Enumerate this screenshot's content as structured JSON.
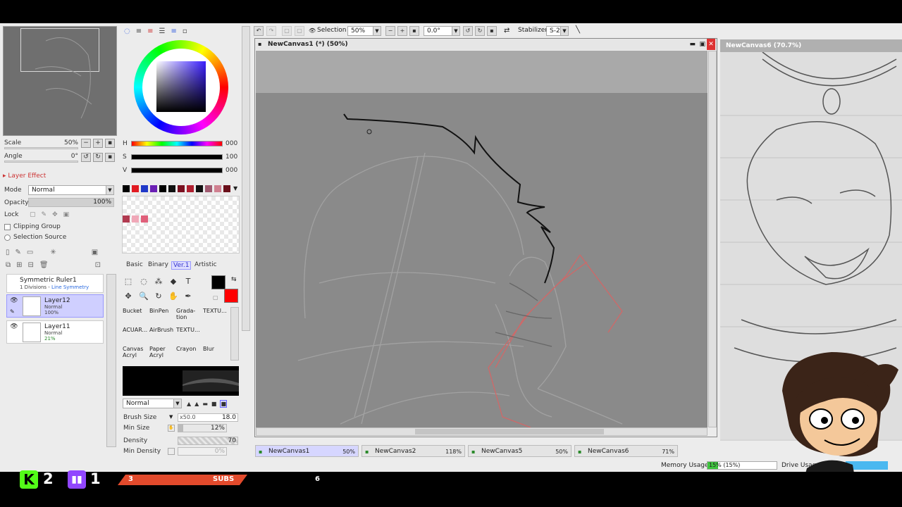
{
  "navigator": {
    "scale_label": "Scale",
    "scale_value": "50%",
    "angle_label": "Angle",
    "angle_value": "0°"
  },
  "layer_panel": {
    "effect_label": "Layer Effect",
    "mode_label": "Mode",
    "mode_value": "Normal",
    "opacity_label": "Opacity",
    "opacity_value": "100%",
    "lock_label": "Lock",
    "clipping_label": "Clipping Group",
    "selection_source_label": "Selection Source",
    "layers": [
      {
        "name": "Symmetric Ruler1",
        "line1": "1 Divisions - ",
        "line1_accent": "Line Symmetry"
      },
      {
        "name": "Layer12",
        "mode": "Normal",
        "opacity": "100%"
      },
      {
        "name": "Layer11",
        "mode": "Normal",
        "opacity": "21%"
      }
    ]
  },
  "color_panel": {
    "h_label": "H",
    "h_value": "000",
    "s_label": "S",
    "s_value": "100",
    "v_label": "V",
    "v_value": "000",
    "palette": [
      "#000000",
      "#e11b22",
      "#2038c8",
      "#6a1fb4",
      "#000000",
      "#101010",
      "#7a1020",
      "#b02030",
      "#101010",
      "#a05a70",
      "#d08090",
      "#6a0f1a"
    ],
    "scratch_swatches": [
      "#b13a50",
      "#f0a8b8",
      "#e05f7a"
    ]
  },
  "tools": {
    "tabs": [
      "Basic",
      "Binary",
      "Ver.1",
      "Artistic"
    ],
    "brushes": [
      "Bucket",
      "BinPen",
      "Grada-tion",
      "TEXTU...",
      "ACUAR...",
      "AirBrush",
      "TEXTU...",
      "",
      "Canvas Acryl",
      "Paper Acryl",
      "Crayon",
      "Blur"
    ],
    "blend_mode": "Normal",
    "brush_size_label": "Brush Size",
    "brush_size_mult": "x50.0",
    "brush_size_value": "18.0",
    "min_size_label": "Min Size",
    "min_size_value": "12%",
    "density_label": "Density",
    "density_value": "70",
    "min_density_label": "Min Density",
    "min_density_value": "0%"
  },
  "toolbar": {
    "selection_label": "Selection",
    "zoom_value": "50%",
    "rotation_value": "0.0°",
    "stabilizer_label": "Stabilizer",
    "stabilizer_value": "S-2"
  },
  "main_window": {
    "title": "NewCanvas1 (*) (50%)"
  },
  "side_window": {
    "title": "NewCanvas6 (70.7%)"
  },
  "canvas_tabs": [
    {
      "name": "NewCanvas1",
      "zoom": "50%"
    },
    {
      "name": "NewCanvas2",
      "zoom": "118%"
    },
    {
      "name": "NewCanvas5",
      "zoom": "50%"
    },
    {
      "name": "NewCanvas6",
      "zoom": "71%"
    }
  ],
  "status": {
    "memory_label": "Memory Usage",
    "memory_value": "15% (15%)",
    "memory_fraction": 0.15,
    "drive_label": "Drive Usag"
  },
  "overlay": {
    "kick_count": "2",
    "twitch_count": "1",
    "subs_left": "3",
    "subs_label": "SUBS",
    "subs_right": "6"
  }
}
